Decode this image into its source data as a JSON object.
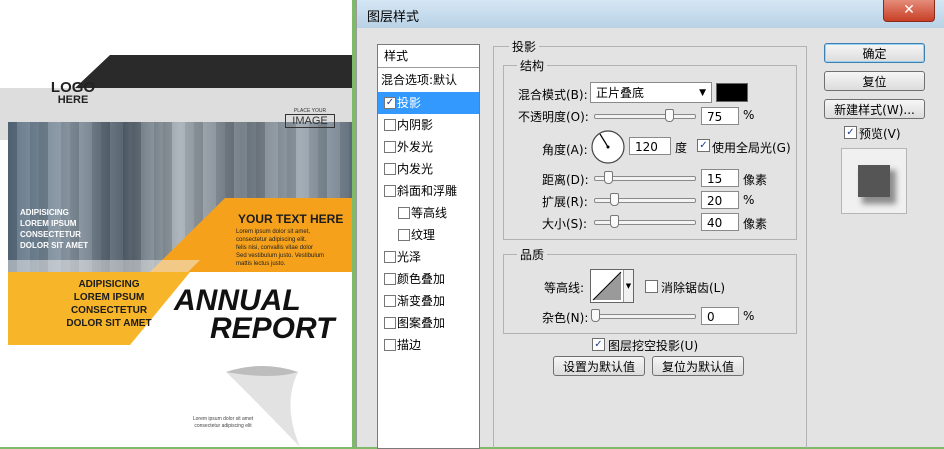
{
  "document": {
    "logo_line1": "LOGO",
    "logo_line2": "HERE",
    "place_line1": "PLACE YOUR",
    "place_line2": "IMAGE",
    "left_lines": [
      "ADIPISICING",
      "LOREM IPSUM",
      "CONSECTETUR",
      "DOLOR SIT AMET"
    ],
    "your_text": "YOUR TEXT HERE",
    "your_text_body": [
      "Lorem ipsum dolor sit amet,",
      "consectetur adipiscing elit.",
      "felis nisi, convallis vitae dolor",
      "Sed vestibulum justo. Vestibulum",
      "mattis lectus justo."
    ],
    "yellow_lines": [
      "ADIPISICING",
      "LOREM IPSUM",
      "CONSECTETUR",
      "DOLOR SIT AMET"
    ],
    "annual": "ANNUAL",
    "report": "REPORT",
    "footer_lines": [
      "Lorem ipsum dolor sit amet",
      "consectetur adipiscing elit"
    ],
    "colors": {
      "accent": "#f5a11c",
      "dark": "#2a2a2a"
    }
  },
  "dialog": {
    "title": "图层样式",
    "close": "✕",
    "style_list": {
      "header": "样式",
      "blend_default": "混合选项:默认",
      "items": [
        {
          "label": "投影",
          "checked": true,
          "selected": true
        },
        {
          "label": "内阴影",
          "checked": false
        },
        {
          "label": "外发光",
          "checked": false
        },
        {
          "label": "内发光",
          "checked": false
        },
        {
          "label": "斜面和浮雕",
          "checked": false
        },
        {
          "label": "等高线",
          "checked": false,
          "indent": true
        },
        {
          "label": "纹理",
          "checked": false,
          "indent": true
        },
        {
          "label": "光泽",
          "checked": false
        },
        {
          "label": "颜色叠加",
          "checked": false
        },
        {
          "label": "渐变叠加",
          "checked": false
        },
        {
          "label": "图案叠加",
          "checked": false
        },
        {
          "label": "描边",
          "checked": false
        }
      ]
    },
    "drop_shadow": {
      "title": "投影",
      "structure_title": "结构",
      "blend_mode_label": "混合模式(B):",
      "blend_mode_value": "正片叠底",
      "shadow_color": "#000000",
      "opacity_label": "不透明度(O):",
      "opacity_value": "75",
      "opacity_unit": "%",
      "angle_label": "角度(A):",
      "angle_value": "120",
      "angle_unit": "度",
      "global_light_label": "使用全局光(G)",
      "global_light_checked": true,
      "distance_label": "距离(D):",
      "distance_value": "15",
      "distance_unit": "像素",
      "spread_label": "扩展(R):",
      "spread_value": "20",
      "spread_unit": "%",
      "size_label": "大小(S):",
      "size_value": "40",
      "size_unit": "像素",
      "quality_title": "品质",
      "contour_label": "等高线:",
      "anti_alias_label": "消除锯齿(L)",
      "anti_alias_checked": false,
      "noise_label": "杂色(N):",
      "noise_value": "0",
      "noise_unit": "%",
      "knockout_label": "图层挖空投影(U)",
      "knockout_checked": true,
      "make_default": "设置为默认值",
      "reset_default": "复位为默认值"
    },
    "buttons": {
      "ok": "确定",
      "reset": "复位",
      "new_style": "新建样式(W)...",
      "preview_label": "预览(V)",
      "preview_checked": true
    }
  }
}
